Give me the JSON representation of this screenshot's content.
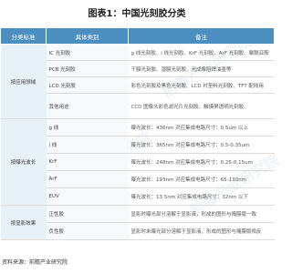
{
  "title": "图表1：中国光刻胶分类",
  "columns": [
    "分类标准",
    "具体类别",
    "备注"
  ],
  "groups": [
    {
      "name": "按应用领域",
      "rows": [
        {
          "sub": "IC 光刻胶",
          "note": "g 线光刻胶、i 线光刻胶、KrF 光刻胶、ArF 光刻胶、聚酰亚胺"
        },
        {
          "sub": "PCB 光刻胶",
          "note": "干膜光刻胶、湿膜光刻胶、光成像阻焊油墨等"
        },
        {
          "sub": "LCD 光刻胶",
          "note": "彩色光刻胶及黑色光刻胶、LCD 衬垫料光刻胶、TFT 配线用"
        },
        {
          "sub": "其他用途",
          "note": "CCD 图像头彩色滤光片光刻胶、触摸屏透明光刻胶、"
        }
      ]
    },
    {
      "name": "按曝光波长",
      "rows": [
        {
          "sub": "g 线",
          "note": "曝光波长：436nm 对应集成电路尺寸：0.5um 以上"
        },
        {
          "sub": "i 线",
          "note": "曝光波长：365nm 对应集成电路尺寸：0.5-0.35um"
        },
        {
          "sub": "KrF",
          "note": "曝光波长：248nm 对应集成电路尺寸：0.25-0.15um"
        },
        {
          "sub": "ArF",
          "note": "曝光波长：193nm 对应集成电路尺寸：65-130nm"
        },
        {
          "sub": "EUV",
          "note": "曝光波长：13.5nm 对应集成电路尺寸：32nm 以下"
        }
      ]
    },
    {
      "name": "按显影效果",
      "rows": [
        {
          "sub": "正性胶",
          "note": "显影时曝光部分溶解于显影液，形成的图形与掩膜版一致"
        },
        {
          "sub": "负性胶",
          "note": "显影时未曝光部分溶解于显影液，形成的图形与掩膜版相反"
        }
      ]
    }
  ],
  "footer": "资料来源：前瞻产业研究院",
  "watermark": "前瞻产业研究院"
}
